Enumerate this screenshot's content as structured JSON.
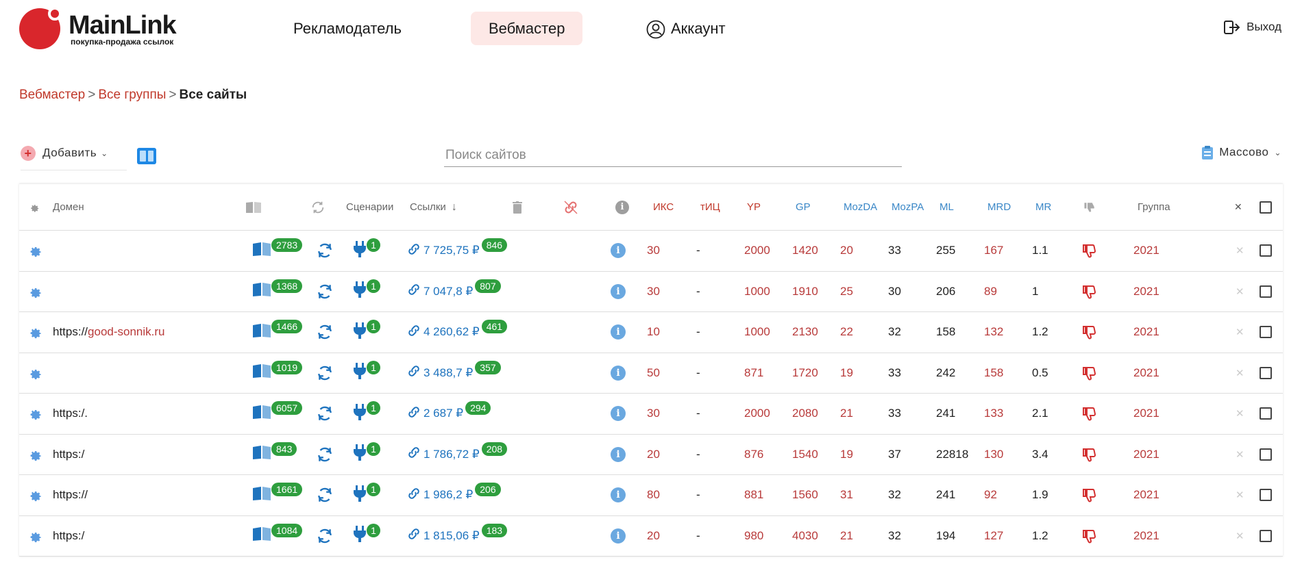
{
  "header": {
    "logo_title": "MainLink",
    "logo_subtitle": "покупка-продажа ссылок",
    "nav": {
      "advertiser": "Рекламодатель",
      "webmaster": "Вебмастер",
      "account": "Аккаунт"
    },
    "logout": "Выход"
  },
  "breadcrumb": {
    "webmaster": "Вебмастер",
    "all_groups": "Все группы",
    "current": "Все сайты",
    "separator": ">"
  },
  "toolbar": {
    "add_label": "Добавить",
    "search_placeholder": "Поиск сайтов",
    "mass_label": "Массово"
  },
  "colors": {
    "accent_red": "#d9262c",
    "link_blue": "#1e73be",
    "badge_green": "#2e9e3e",
    "nav_active_bg": "#fde8e6"
  },
  "table": {
    "headers": {
      "domain": "Домен",
      "scenarios": "Сценарии",
      "links": "Ссылки",
      "iks": "ИКС",
      "tic": "тИЦ",
      "yp": "YP",
      "gp": "GP",
      "mozda": "MozDA",
      "mozpa": "MozPA",
      "ml": "ML",
      "mrd": "MRD",
      "mr": "MR",
      "group": "Группа"
    },
    "rows": [
      {
        "domain_prefix": "",
        "domain_name": "",
        "pages": "2783",
        "scen": "1",
        "price": "7 725,75 ₽",
        "links": "846",
        "iks": "30",
        "tic": "-",
        "yp": "2000",
        "gp": "1420",
        "mozda": "20",
        "mozpa": "33",
        "ml": "255",
        "mrd": "167",
        "mr": "1.1",
        "group": "2021"
      },
      {
        "domain_prefix": "",
        "domain_name": "",
        "pages": "1368",
        "scen": "1",
        "price": "7 047,8 ₽",
        "links": "807",
        "iks": "30",
        "tic": "-",
        "yp": "1000",
        "gp": "1910",
        "mozda": "25",
        "mozpa": "30",
        "ml": "206",
        "mrd": "89",
        "mr": "1",
        "group": "2021"
      },
      {
        "domain_prefix": "https://",
        "domain_name": "good-sonnik.ru",
        "pages": "1466",
        "scen": "1",
        "price": "4 260,62 ₽",
        "links": "461",
        "iks": "10",
        "tic": "-",
        "yp": "1000",
        "gp": "2130",
        "mozda": "22",
        "mozpa": "32",
        "ml": "158",
        "mrd": "132",
        "mr": "1.2",
        "group": "2021"
      },
      {
        "domain_prefix": "",
        "domain_name": "",
        "pages": "1019",
        "scen": "1",
        "price": "3 488,7 ₽",
        "links": "357",
        "iks": "50",
        "tic": "-",
        "yp": "871",
        "gp": "1720",
        "mozda": "19",
        "mozpa": "33",
        "ml": "242",
        "mrd": "158",
        "mr": "0.5",
        "group": "2021"
      },
      {
        "domain_prefix": "https:/.",
        "domain_name": "",
        "pages": "6057",
        "scen": "1",
        "price": "2 687 ₽",
        "links": "294",
        "iks": "30",
        "tic": "-",
        "yp": "2000",
        "gp": "2080",
        "mozda": "21",
        "mozpa": "33",
        "ml": "241",
        "mrd": "133",
        "mr": "2.1",
        "group": "2021"
      },
      {
        "domain_prefix": "https:/",
        "domain_name": "",
        "pages": "843",
        "scen": "1",
        "price": "1 786,72 ₽",
        "links": "208",
        "iks": "20",
        "tic": "-",
        "yp": "876",
        "gp": "1540",
        "mozda": "19",
        "mozpa": "37",
        "ml": "22818",
        "mrd": "130",
        "mr": "3.4",
        "group": "2021"
      },
      {
        "domain_prefix": "https://",
        "domain_name": "",
        "pages": "1661",
        "scen": "1",
        "price": "1 986,2 ₽",
        "links": "206",
        "iks": "80",
        "tic": "-",
        "yp": "881",
        "gp": "1560",
        "mozda": "31",
        "mozpa": "32",
        "ml": "241",
        "mrd": "92",
        "mr": "1.9",
        "group": "2021"
      },
      {
        "domain_prefix": "https:/",
        "domain_name": "",
        "pages": "1084",
        "scen": "1",
        "price": "1 815,06 ₽",
        "links": "183",
        "iks": "20",
        "tic": "-",
        "yp": "980",
        "gp": "4030",
        "mozda": "21",
        "mozpa": "32",
        "ml": "194",
        "mrd": "127",
        "mr": "1.2",
        "group": "2021"
      }
    ]
  }
}
